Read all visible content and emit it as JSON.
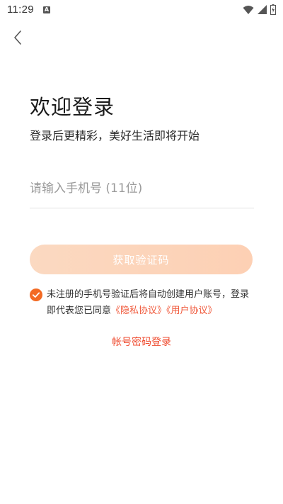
{
  "status_bar": {
    "time": "11:29",
    "notification_icon": "A"
  },
  "header": {
    "back_icon": "chevron-left-icon"
  },
  "main": {
    "title": "欢迎登录",
    "subtitle": "登录后更精彩，美好生活即将开始",
    "phone_placeholder": "请输入手机号 (11位)",
    "phone_value": "",
    "get_code_label": "获取验证码",
    "agreement": {
      "checked": true,
      "text": "未注册的手机号验证后将自动创建用户账号，登录即代表您已同意",
      "privacy_link": "《隐私协议》",
      "user_link": "《用户协议》"
    },
    "password_login_label": "帐号密码登录"
  },
  "colors": {
    "accent": "#f0583a",
    "button_gradient_start": "#fbd9c1",
    "button_gradient_end": "#fdd0b4",
    "check_color": "#f36a23"
  }
}
